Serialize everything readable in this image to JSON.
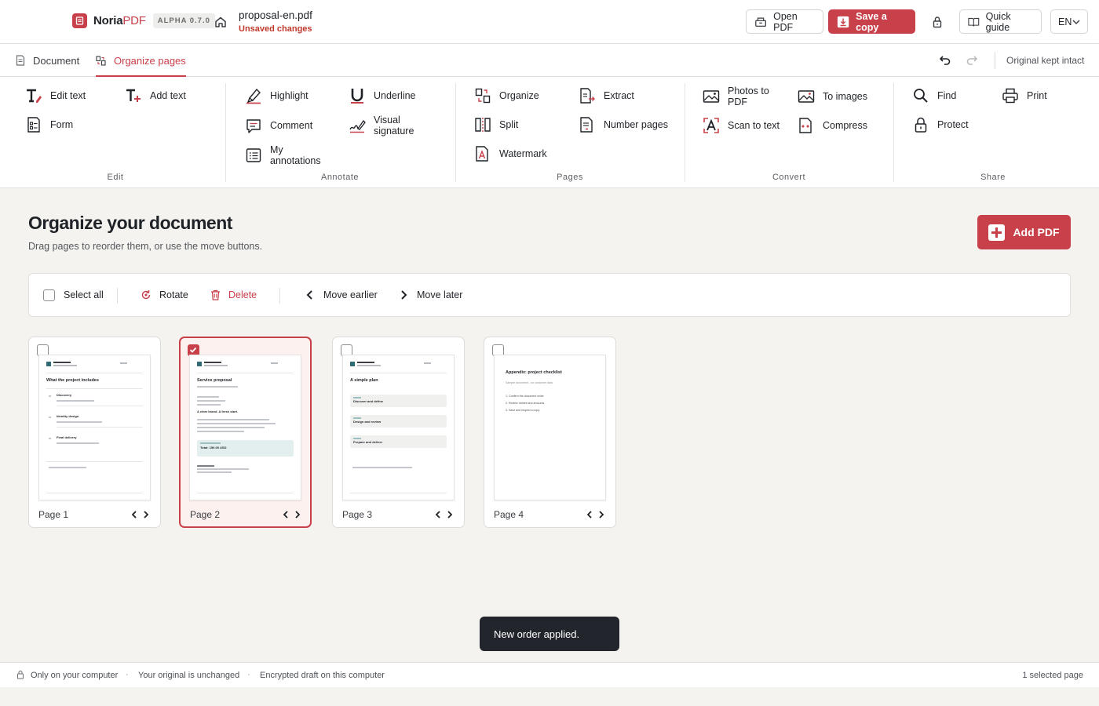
{
  "header": {
    "brand_name": "Noria",
    "brand_accent": "PDF",
    "version_badge": "ALPHA 0.7.0",
    "file_name": "proposal-en.pdf",
    "file_status": "Unsaved changes",
    "open_pdf_label": "Open PDF",
    "save_copy_label": "Save a copy",
    "quick_guide_label": "Quick guide",
    "language": "EN"
  },
  "tabs": {
    "document": "Document",
    "organize": "Organize pages",
    "active": "organize",
    "original_note": "Original kept intact"
  },
  "ribbon": {
    "groups": {
      "edit": "Edit",
      "annotate": "Annotate",
      "pages": "Pages",
      "convert": "Convert",
      "share": "Share"
    },
    "tools": {
      "edit_text": "Edit text",
      "add_text": "Add text",
      "form": "Form",
      "highlight": "Highlight",
      "underline": "Underline",
      "comment": "Comment",
      "visual_signature_1": "Visual",
      "visual_signature_2": "signature",
      "my_annotations_1": "My",
      "my_annotations_2": "annotations",
      "organize": "Organize",
      "extract": "Extract",
      "split": "Split",
      "number_pages": "Number pages",
      "watermark": "Watermark",
      "photos_to_pdf_1": "Photos to",
      "photos_to_pdf_2": "PDF",
      "to_images": "To images",
      "scan_to_text": "Scan to text",
      "compress": "Compress",
      "find": "Find",
      "print": "Print",
      "protect": "Protect"
    }
  },
  "main": {
    "title": "Organize your document",
    "subtitle": "Drag pages to reorder them, or use the move buttons.",
    "add_pdf_label": "Add PDF",
    "toolbar": {
      "select_all": "Select all",
      "rotate": "Rotate",
      "delete": "Delete",
      "move_earlier": "Move earlier",
      "move_later": "Move later"
    },
    "pages": [
      {
        "label": "Page 1",
        "selected": false,
        "thumb_title": "What the project includes",
        "items": [
          "Discovery",
          "Identity design",
          "Final delivery"
        ]
      },
      {
        "label": "Page 2",
        "selected": true,
        "thumb_title": "Service proposal",
        "subheading": "A clear brand. A fresh start.",
        "total": "Total: 150.00 USD"
      },
      {
        "label": "Page 3",
        "selected": false,
        "thumb_title": "A simple plan",
        "items": [
          "Discover and define",
          "Design and review",
          "Prepare and deliver"
        ]
      },
      {
        "label": "Page 4",
        "selected": false,
        "thumb_title": "Appendix: project checklist",
        "thumb_subtitle": "Sample document - no customer data",
        "items": [
          "1. Confirm the document order.",
          "2. Review names and amounts.",
          "3. Save and inspect a copy."
        ]
      }
    ]
  },
  "toast": "New order applied.",
  "status": {
    "local": "Only on your computer",
    "original": "Your original is unchanged",
    "draft": "Encrypted draft on this computer",
    "selection": "1 selected page"
  },
  "colors": {
    "accent": "#c8404a",
    "background": "#f4f3f0",
    "toast": "#22262c"
  },
  "icons": [
    "home-icon",
    "open-file-icon",
    "download-icon",
    "lock-icon",
    "book-icon",
    "chevron-down-icon",
    "undo-icon",
    "redo-icon",
    "rotate-icon",
    "trash-icon",
    "chevron-left-icon",
    "chevron-right-icon",
    "check-icon"
  ]
}
